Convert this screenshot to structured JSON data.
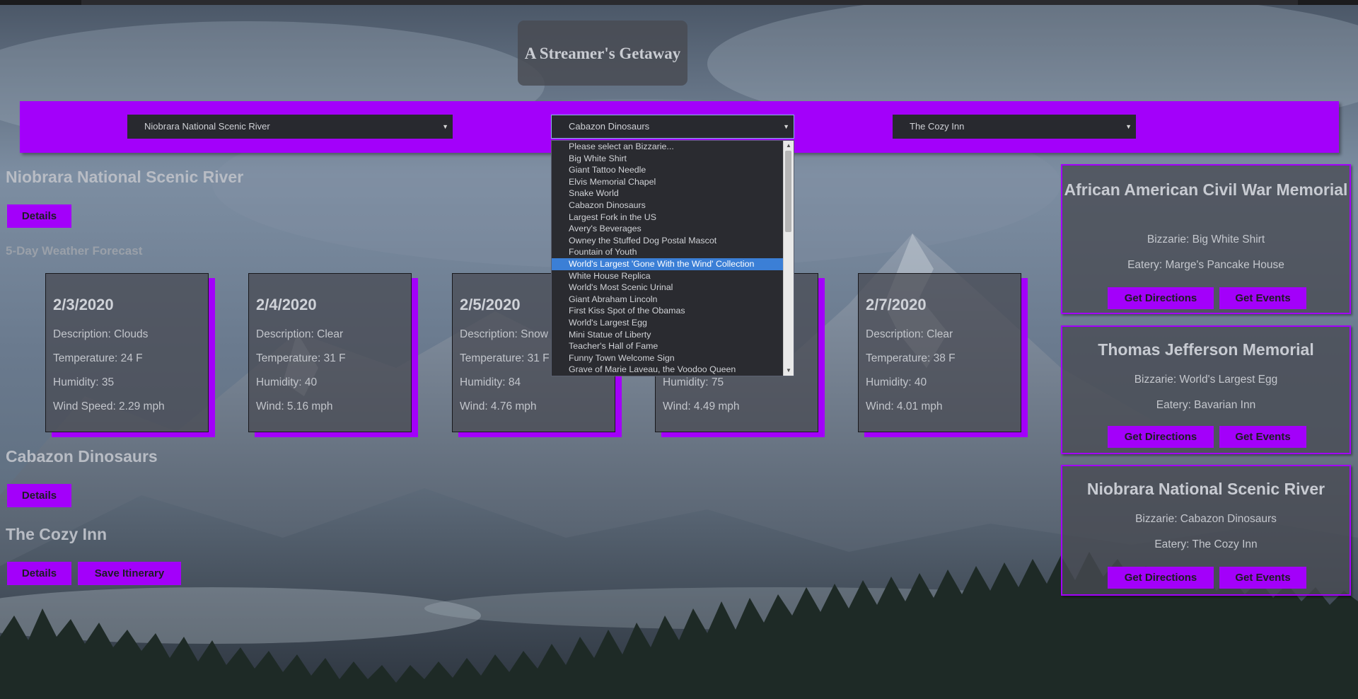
{
  "app": {
    "title": "A Streamer's Getaway"
  },
  "selects": {
    "park": "Niobrara National Scenic River",
    "bizzarie": "Cabazon Dinosaurs",
    "eatery": "The Cozy Inn"
  },
  "dropdown": {
    "options": [
      "Please select an Bizzarie...",
      "Big White Shirt",
      "Giant Tattoo Needle",
      "Elvis Memorial Chapel",
      "Snake World",
      "Cabazon Dinosaurs",
      "Largest Fork in the US",
      "Avery's Beverages",
      "Owney the Stuffed Dog Postal Mascot",
      "Fountain of Youth",
      "World's Largest 'Gone With the Wind' Collection",
      "White House Replica",
      "World's Most Scenic Urinal",
      "Giant Abraham Lincoln",
      "First Kiss Spot of the Obamas",
      "World's Largest Egg",
      "Mini Statue of Liberty",
      "Teacher's Hall of Fame",
      "Funny Town Welcome Sign",
      "Grave of Marie Laveau, the Voodoo Queen"
    ],
    "highlighted": "World's Largest 'Gone With the Wind' Collection"
  },
  "park_section": {
    "title": "Niobrara National Scenic River",
    "details_label": "Details"
  },
  "forecast": {
    "title": "5-Day Weather Forecast",
    "cards": [
      {
        "date": "2/3/2020",
        "description": "Description: Clouds",
        "temperature": "Temperature: 24 F",
        "humidity": "Humidity: 35",
        "wind": "Wind Speed: 2.29 mph"
      },
      {
        "date": "2/4/2020",
        "description": "Description: Clear",
        "temperature": "Temperature: 31 F",
        "humidity": "Humidity: 40",
        "wind": "Wind: 5.16 mph"
      },
      {
        "date": "2/5/2020",
        "description": "Description: Snow",
        "temperature": "Temperature: 31 F",
        "humidity": "Humidity: 84",
        "wind": "Wind: 4.76 mph"
      },
      {
        "date": "",
        "description": "",
        "temperature": "",
        "humidity": "Humidity: 75",
        "wind": "Wind: 4.49 mph"
      },
      {
        "date": "2/7/2020",
        "description": "Description: Clear",
        "temperature": "Temperature: 38 F",
        "humidity": "Humidity: 40",
        "wind": "Wind: 4.01 mph"
      }
    ]
  },
  "bizzarie_section": {
    "title": "Cabazon Dinosaurs",
    "details_label": "Details"
  },
  "eatery_section": {
    "title": "The Cozy Inn",
    "details_label": "Details",
    "save_label": "Save Itinerary"
  },
  "itineraries": [
    {
      "title": "African American Civil War Memorial",
      "bizzarie": "Bizzarie: Big White Shirt",
      "eatery": "Eatery: Marge's Pancake House",
      "directions_label": "Get Directions",
      "events_label": "Get Events"
    },
    {
      "title": "Thomas Jefferson Memorial",
      "bizzarie": "Bizzarie: World's Largest Egg",
      "eatery": "Eatery: Bavarian Inn",
      "directions_label": "Get Directions",
      "events_label": "Get Events"
    },
    {
      "title": "Niobrara National Scenic River",
      "bizzarie": "Bizzarie: Cabazon Dinosaurs",
      "eatery": "Eatery: The Cozy Inn",
      "directions_label": "Get Directions",
      "events_label": "Get Events"
    }
  ],
  "colors": {
    "accent": "#a300fa",
    "select_bg": "#28292f",
    "highlight": "#3b7fd6"
  },
  "icons": {
    "select_caret": "caret-down-icon",
    "scroll_up": "scroll-up-arrow-icon",
    "scroll_down": "scroll-down-arrow-icon"
  }
}
